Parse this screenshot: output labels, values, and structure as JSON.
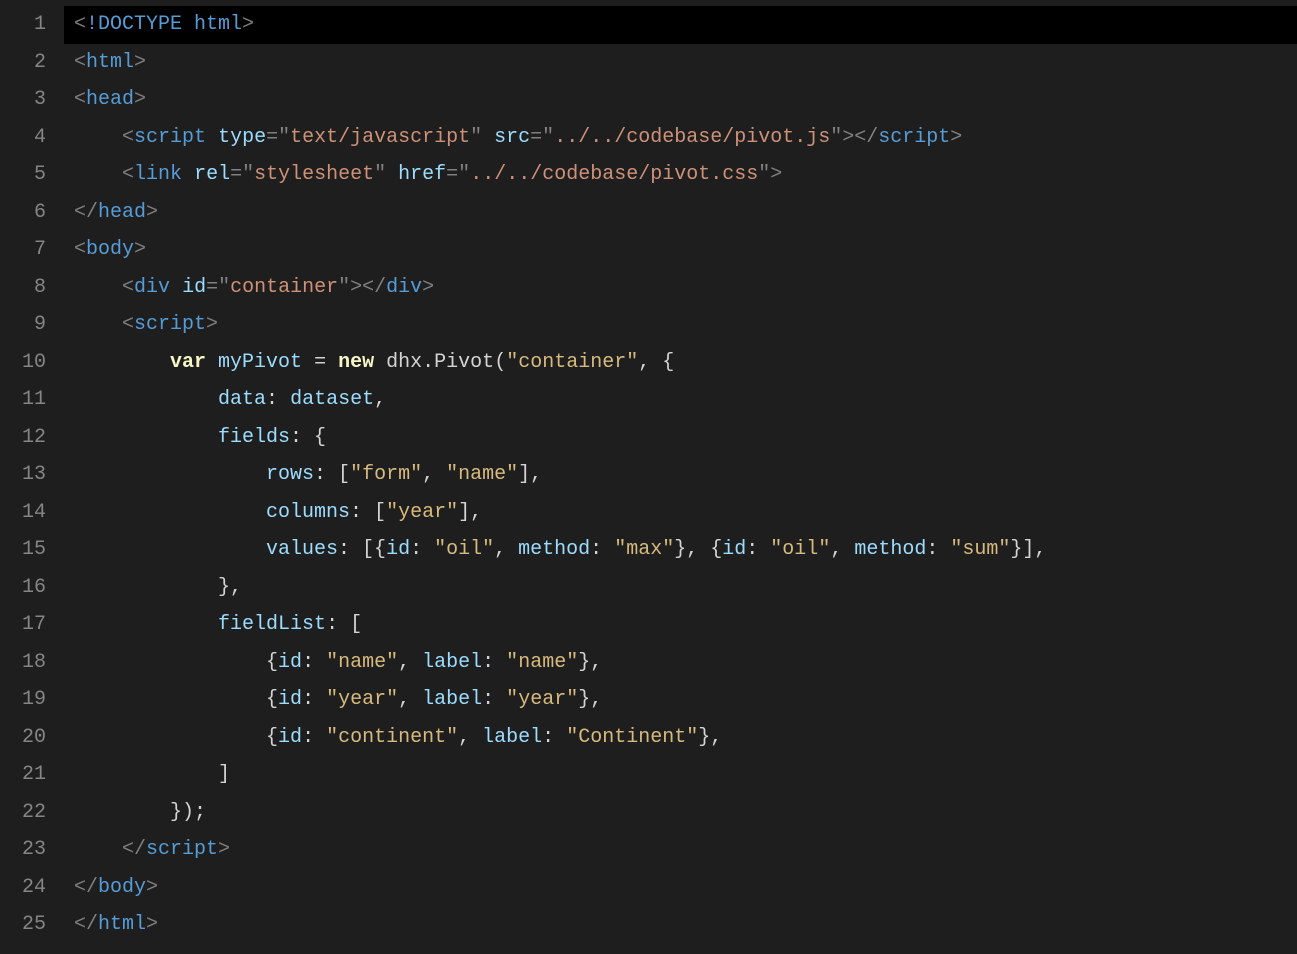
{
  "lines": {
    "1": {
      "doctype": "!DOCTYPE html"
    },
    "2": {
      "tag": "html"
    },
    "3": {
      "tag": "head"
    },
    "4": {
      "tag": "script",
      "attrs": [
        {
          "n": "type",
          "v": "text/javascript"
        },
        {
          "n": "src",
          "v": "../../codebase/pivot.js"
        }
      ],
      "close": "script"
    },
    "5": {
      "tag": "link",
      "attrs": [
        {
          "n": "rel",
          "v": "stylesheet"
        },
        {
          "n": "href",
          "v": "../../codebase/pivot.css"
        }
      ]
    },
    "6": {
      "closetag": "head"
    },
    "7": {
      "tag": "body"
    },
    "8": {
      "tag": "div",
      "attrs": [
        {
          "n": "id",
          "v": "container"
        }
      ],
      "close": "div"
    },
    "9": {
      "tag": "script"
    },
    "10": {
      "kw1": "var",
      "id": "myPivot",
      "kw2": "new",
      "ns": "dhx",
      "cls": "Pivot",
      "arg": "container"
    },
    "11": {
      "key": "data",
      "val": "dataset"
    },
    "12": {
      "key": "fields"
    },
    "13": {
      "key": "rows",
      "arr": [
        "form",
        "name"
      ]
    },
    "14": {
      "key": "columns",
      "arr": [
        "year"
      ]
    },
    "15": {
      "key": "values",
      "objs": [
        {
          "id": "oil",
          "method": "max"
        },
        {
          "id": "oil",
          "method": "sum"
        }
      ]
    },
    "17": {
      "key": "fieldList"
    },
    "18": {
      "id": "name",
      "label": "name"
    },
    "19": {
      "id": "year",
      "label": "year"
    },
    "20": {
      "id": "continent",
      "label": "Continent"
    },
    "23": {
      "closetag": "script"
    },
    "24": {
      "closetag": "body"
    },
    "25": {
      "closetag": "html"
    }
  },
  "gutter": [
    "1",
    "2",
    "3",
    "4",
    "5",
    "6",
    "7",
    "8",
    "9",
    "10",
    "11",
    "12",
    "13",
    "14",
    "15",
    "16",
    "17",
    "18",
    "19",
    "20",
    "21",
    "22",
    "23",
    "24",
    "25"
  ]
}
